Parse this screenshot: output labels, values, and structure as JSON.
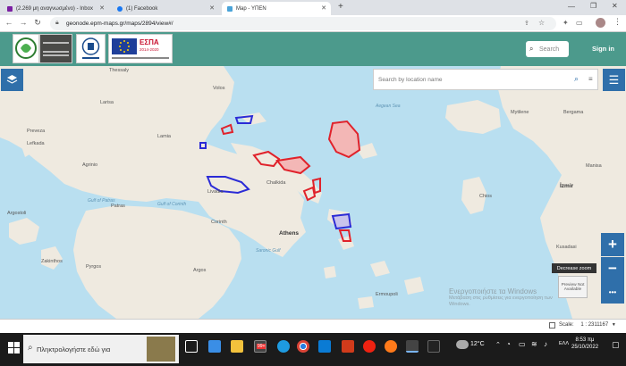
{
  "browser": {
    "tabs": [
      {
        "label": "(2.269 μη αναγνωσμένο) - Inbox",
        "active": false
      },
      {
        "label": "(1) Facebook",
        "active": false
      },
      {
        "label": "Map - ΥΠΕΝ",
        "active": true
      }
    ],
    "new_tab_label": "+",
    "url": "geonode.epm-maps.gr/maps/2894/view#/"
  },
  "header": {
    "search_placeholder": "Search",
    "sign_in_label": "Sign in",
    "espa_label": "ΕΣΠΑ",
    "espa_years": "2014-2020"
  },
  "map": {
    "location_search_placeholder": "Search by location name",
    "labels": {
      "thessaly": "Thessaly",
      "volos": "Volos",
      "larisa": "Larisa",
      "lamia": "Lamia",
      "chalkida": "Chalkida",
      "athens": "Athens",
      "patras": "Patras",
      "corinth": "Corinth",
      "argos": "Argos",
      "pyrgos": "Pyrgos",
      "livadia": "Livadia",
      "agrinio": "Agrinio",
      "preveza": "Preveza",
      "lefkada": "Lefkada",
      "argostoli": "Argostoli",
      "zakinthos": "Zakinthos",
      "gulf_patras": "Gulf of Patras",
      "gulf_corinth": "Gulf of Corinth",
      "saronic": "Saronic Gulf",
      "aegean": "Aegean Sea",
      "mytilene": "Mytilene",
      "bergama": "Bergama",
      "manisa": "Manisa",
      "izmir": "İzmir",
      "chios": "Chios",
      "kusadasi": "Kusadasi",
      "ermoupoli": "Ermoupoli"
    },
    "tooltip": "Decrease zoom",
    "preview_box": "Preview Not Available",
    "zoom_in": "+",
    "zoom_out": "−",
    "more": "•••",
    "scale_label": "Scale:",
    "scale_value": "1 : 2311167"
  },
  "watermark": {
    "title": "Ενεργοποιήστε τα Windows",
    "subtitle": "Μετάβαση στις ρυθμίσεις για ενεργοποίηση των Windows."
  },
  "taskbar": {
    "search_placeholder": "Πληκτρολογήστε εδώ για",
    "badge": "99+",
    "temperature": "12°C",
    "language": "ΕΛΛ",
    "time": "8:53 πμ",
    "date": "25/10/2022"
  },
  "colors": {
    "header": "#4c9a8c",
    "map_button": "#2f6faa",
    "land": "#efeae0",
    "sea": "#b9dff0",
    "overlay_red": "#e0222b",
    "overlay_blue": "#2b2bd6"
  }
}
